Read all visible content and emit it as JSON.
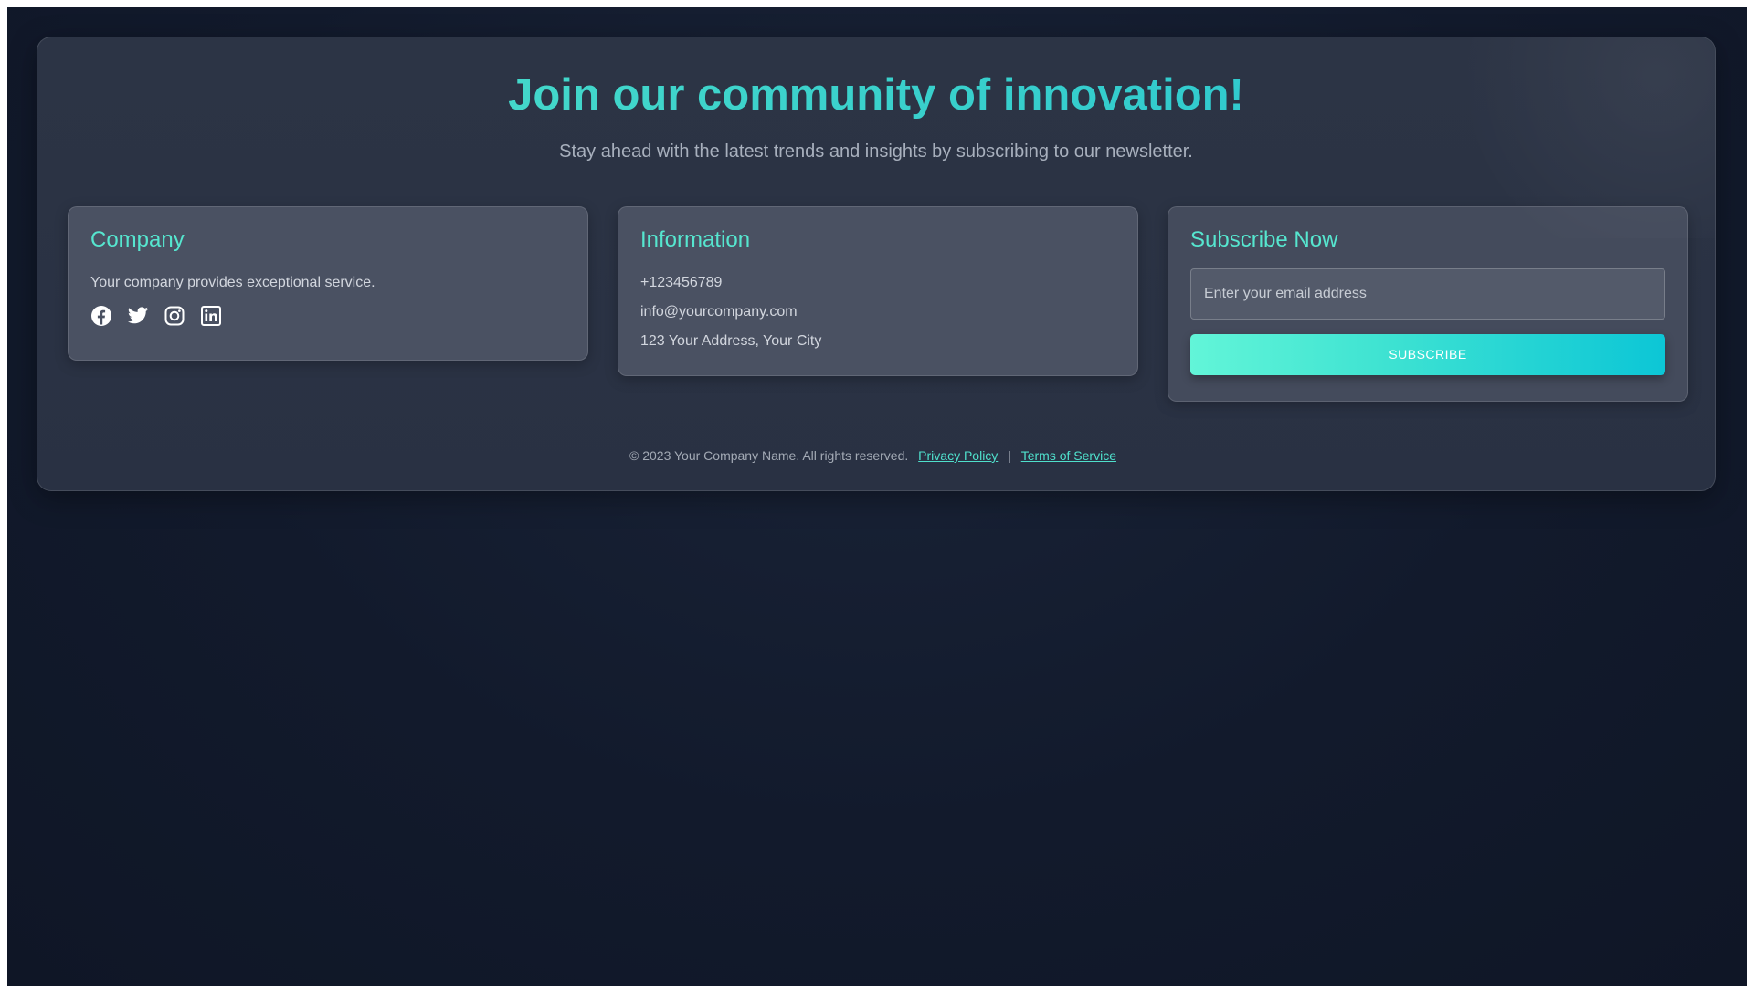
{
  "hero": {
    "title": "Join our community of innovation!",
    "subtitle": "Stay ahead with the latest trends and insights by subscribing to our newsletter."
  },
  "company": {
    "title": "Company",
    "description": "Your company provides exceptional service.",
    "socials": [
      "facebook-icon",
      "twitter-icon",
      "instagram-icon",
      "linkedin-icon"
    ]
  },
  "information": {
    "title": "Information",
    "phone": "+123456789",
    "email": "info@yourcompany.com",
    "address": "123 Your Address, Your City"
  },
  "subscribe": {
    "title": "Subscribe Now",
    "email_placeholder": "Enter your email address",
    "email_value": "",
    "button_label": "Subscribe"
  },
  "footer": {
    "copyright": "© 2023 Your Company Name. All rights reserved.",
    "privacy_label": "Privacy Policy",
    "separator": "|",
    "terms_label": "Terms of Service"
  },
  "colors": {
    "accent": "#56e6cf",
    "button_gradient_start": "#62f5d8",
    "button_gradient_end": "#0cc6d6",
    "background": "#121a2c",
    "card": "#4a5162"
  }
}
